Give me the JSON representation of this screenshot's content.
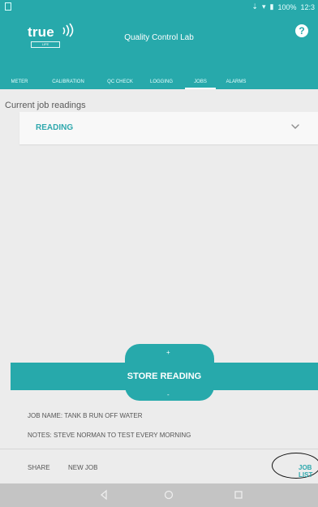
{
  "status": {
    "battery": "100%",
    "time": "12:3"
  },
  "header": {
    "brand": "true",
    "brand_sub": "LIFE",
    "title": "Quality Control Lab",
    "help": "?"
  },
  "tabs": [
    {
      "label": "METER"
    },
    {
      "label": "CALIBRATION"
    },
    {
      "label": "QC CHECK"
    },
    {
      "label": "LOGGING"
    },
    {
      "label": "JOBS"
    },
    {
      "label": "ALARMS"
    }
  ],
  "main": {
    "current_label": "Current job readings",
    "reading_label": "READING"
  },
  "store": {
    "plus": "+",
    "label": "STORE READING",
    "minus": "-"
  },
  "job": {
    "name": "JOB NAME: TANK B RUN OFF WATER",
    "notes": "NOTES: STEVE NORMAN TO TEST EVERY MORNING"
  },
  "footer": {
    "share": "SHARE",
    "new_job": "NEW JOB",
    "job_list": "JOB LIST"
  },
  "icons": [
    "status-icons",
    "signal-icon",
    "wifi-icon",
    "battery-icon",
    "help-icon",
    "chevron-down-icon",
    "back-icon",
    "home-icon",
    "recent-apps-icon"
  ],
  "colors": {
    "primary": "#27a9ab",
    "accent_text": "#2ea8ad",
    "background": "#ececec",
    "nav": "#c4c4c4"
  }
}
